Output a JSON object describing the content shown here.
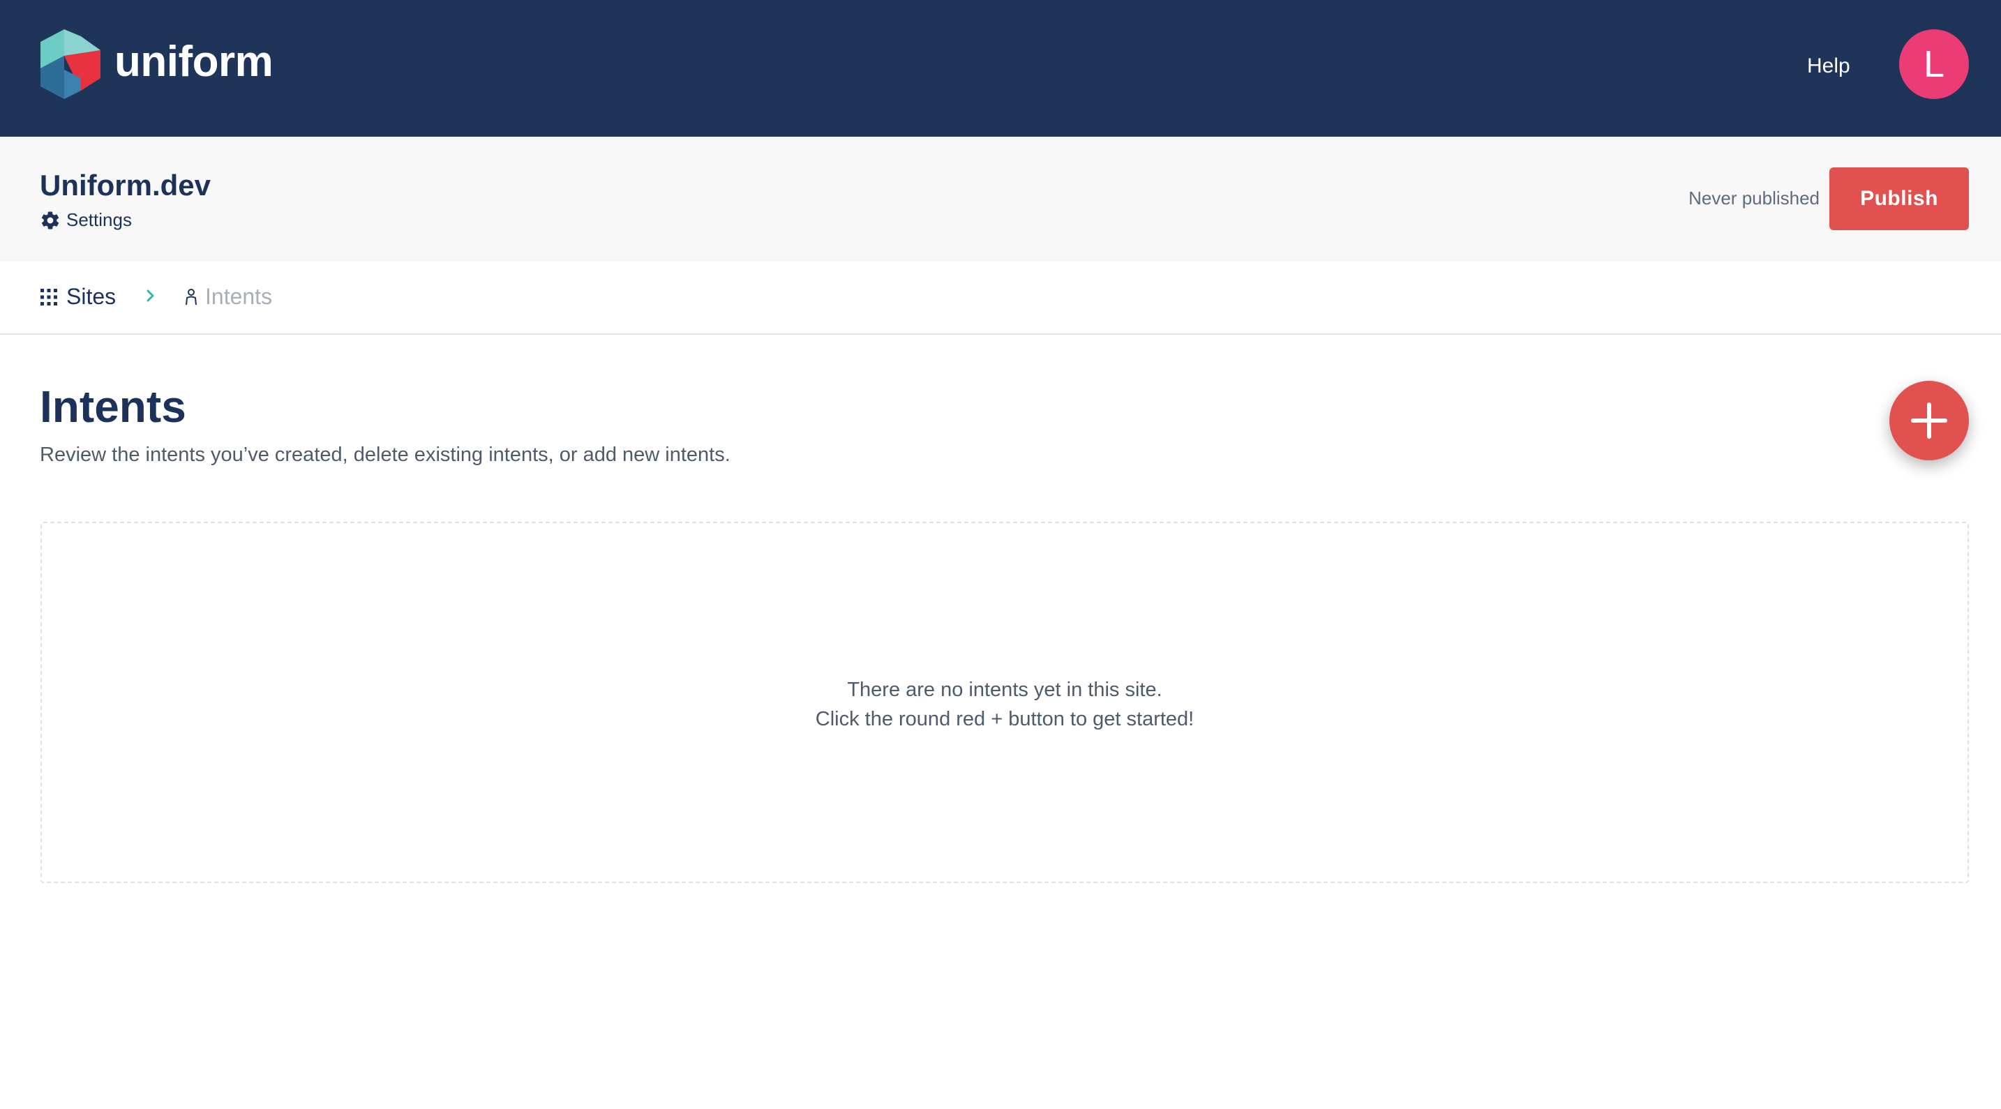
{
  "brand": {
    "name": "uniform",
    "colors": {
      "navbar": "#1e3459",
      "accent_red": "#e0514f",
      "avatar_pink": "#eb3c75"
    }
  },
  "topbar": {
    "help_label": "Help",
    "avatar_initial": "L"
  },
  "site": {
    "name": "Uniform.dev",
    "settings_label": "Settings",
    "settings_icon": "gear-icon",
    "publish_status": "Never published",
    "publish_label": "Publish"
  },
  "breadcrumb": {
    "sites_label": "Sites",
    "sites_icon": "grid-icon",
    "separator_icon": "chevron-right-icon",
    "current_label": "Intents",
    "current_icon": "person-icon"
  },
  "page": {
    "title": "Intents",
    "subtitle": "Review the intents you’ve created, delete existing intents, or add new intents.",
    "add_icon": "plus-icon"
  },
  "empty_state": {
    "line1": "There are no intents yet in this site.",
    "line2": "Click the round red + button to get started!"
  }
}
